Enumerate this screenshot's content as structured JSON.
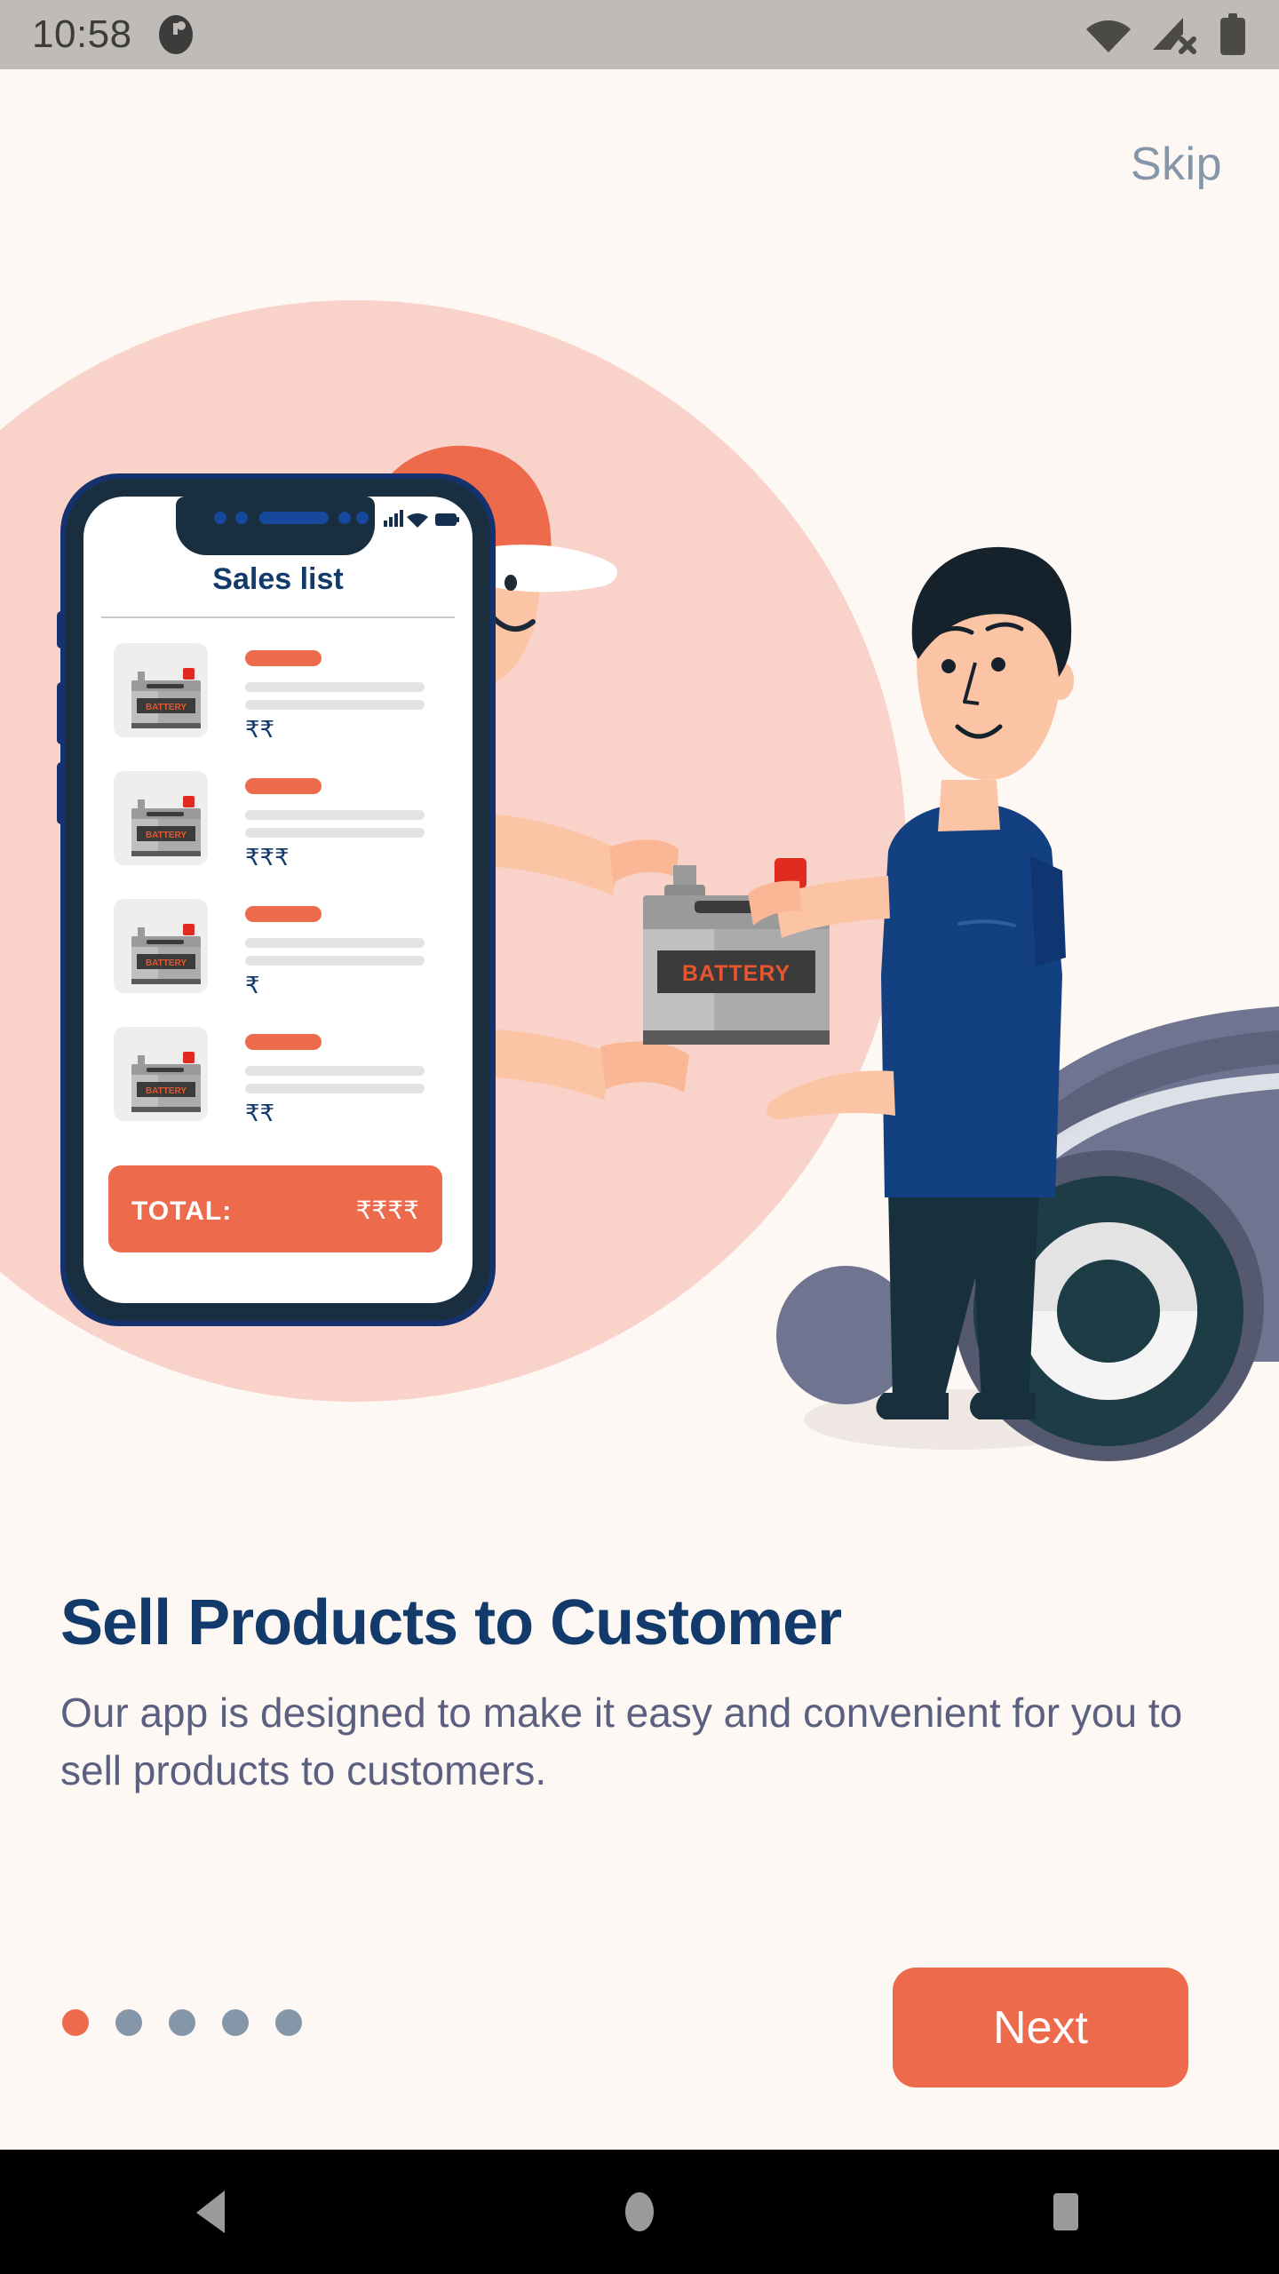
{
  "status_bar": {
    "time": "10:58",
    "left_icons": [
      "clock-badge-icon"
    ],
    "right_icons": [
      "wifi-icon",
      "cellular-no-sim-icon",
      "battery-icon"
    ],
    "background_color": "#BFBBB6"
  },
  "header": {
    "skip_label": "Skip",
    "skip_color": "#8596A8"
  },
  "illustration": {
    "name": "sell-products-illustration",
    "circle_color": "#F9D3CA",
    "background_color": "#FDF8F3",
    "phone_mockup": {
      "screen_title": "Sales list",
      "status_icons": [
        "signal-icon",
        "wifi-icon",
        "battery-icon"
      ],
      "list_items": [
        {
          "product_icon": "car-battery-icon",
          "product_label": "BATTERY",
          "price": "₹₹"
        },
        {
          "product_icon": "car-battery-icon",
          "product_label": "BATTERY",
          "price": "₹₹₹"
        },
        {
          "product_icon": "car-battery-icon",
          "product_label": "BATTERY",
          "price": "₹"
        },
        {
          "product_icon": "car-battery-icon",
          "product_label": "BATTERY",
          "price": "₹₹"
        }
      ],
      "total_label": "TOTAL:",
      "total_value": "₹₹₹₹",
      "total_bar_color": "#EE6A4D",
      "title_color": "#123A6B",
      "price_color": "#123A6B"
    },
    "characters": [
      {
        "name": "delivery-person",
        "cap_color": "#EE6A4D",
        "shirt_color": "#EE6A4D"
      },
      {
        "name": "customer",
        "shirt_color": "#134080",
        "pants_color": "#17303B"
      }
    ],
    "product_in_hands": {
      "label": "BATTERY",
      "body_color": "#9A9A9A"
    },
    "vehicle": {
      "name": "car",
      "body_color": "#6F7490",
      "tire_color": "#1D3C45"
    }
  },
  "main": {
    "headline": "Sell Products to Customer",
    "headline_color": "#123A6B",
    "subtext": "Our app is designed to make it easy and convenient for you to sell products to customers.",
    "subtext_color": "#5C6080"
  },
  "bottom": {
    "pager": {
      "total": 5,
      "active_index": 0,
      "active_color": "#EE6A4D",
      "inactive_color": "#8596A8"
    },
    "next_label": "Next",
    "next_color": "#EE6A4D"
  },
  "nav_bar": {
    "background_color": "#000000",
    "buttons": [
      {
        "name": "back-button",
        "icon": "triangle-left-icon"
      },
      {
        "name": "home-button",
        "icon": "circle-icon"
      },
      {
        "name": "recents-button",
        "icon": "square-icon"
      }
    ]
  }
}
